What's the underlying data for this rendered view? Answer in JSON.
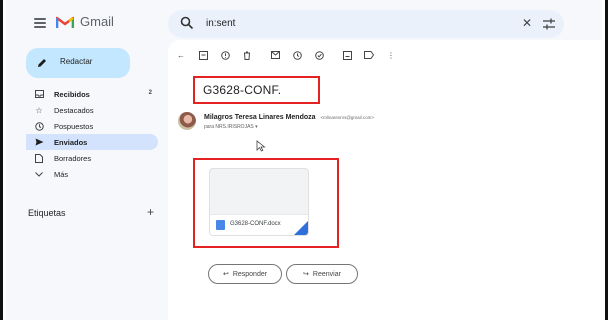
{
  "app": {
    "name": "Gmail"
  },
  "search": {
    "query": "in:sent",
    "clear_symbol": "✕"
  },
  "sidebar": {
    "compose_label": "Redactar",
    "items": [
      {
        "label": "Recibidos",
        "count": "2",
        "icon": "inbox-icon"
      },
      {
        "label": "Destacados",
        "icon": "star-icon"
      },
      {
        "label": "Pospuestos",
        "icon": "clock-icon"
      },
      {
        "label": "Enviados",
        "icon": "send-icon"
      },
      {
        "label": "Borradores",
        "icon": "draft-icon"
      },
      {
        "label": "Más",
        "icon": "chevron-down-icon"
      }
    ],
    "labels_title": "Etiquetas",
    "labels_add": "+"
  },
  "email": {
    "subject": "G3628-CONF.",
    "sender_name": "Milagros Teresa Linares Mendoza",
    "sender_email": "<mlinaresnrs@gmail.com>",
    "to": "para NRS.IRISROJAS ▾",
    "attachment_name": "G3628-CONF.docx"
  },
  "actions": {
    "reply": "Responder",
    "forward": "Reenviar"
  },
  "colors": {
    "accent": "#c2e7ff",
    "active_nav": "#d3e3fd",
    "highlight": "#e52222",
    "search_bg": "#eaf1fb"
  }
}
